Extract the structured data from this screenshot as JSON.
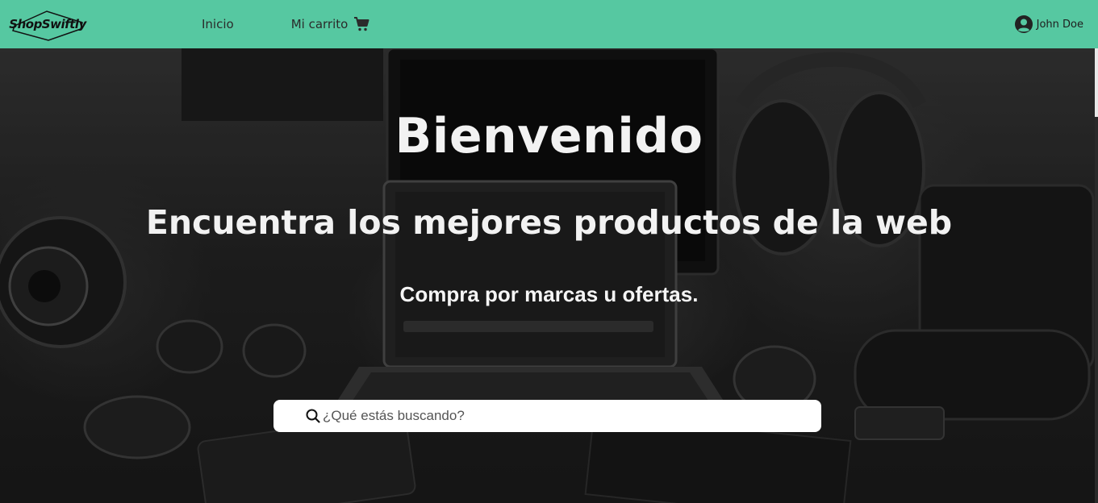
{
  "colors": {
    "navbar": "#56c8a1",
    "hero_text": "#f2f2f2",
    "search_bg": "#ffffff"
  },
  "navbar": {
    "logo_text": "ShopSwiftly",
    "links": [
      {
        "label": "Inicio"
      },
      {
        "label": "Mi carrito",
        "icon": "cart-icon"
      }
    ],
    "user": {
      "name": "John Doe",
      "icon": "user-circle-icon"
    }
  },
  "hero": {
    "title": "Bienvenido",
    "subtitle": "Encuentra los mejores productos de la web",
    "tagline": "Compra por marcas u ofertas.",
    "search": {
      "placeholder": "¿Qué estás buscando?",
      "value": "",
      "icon": "search-icon"
    }
  }
}
